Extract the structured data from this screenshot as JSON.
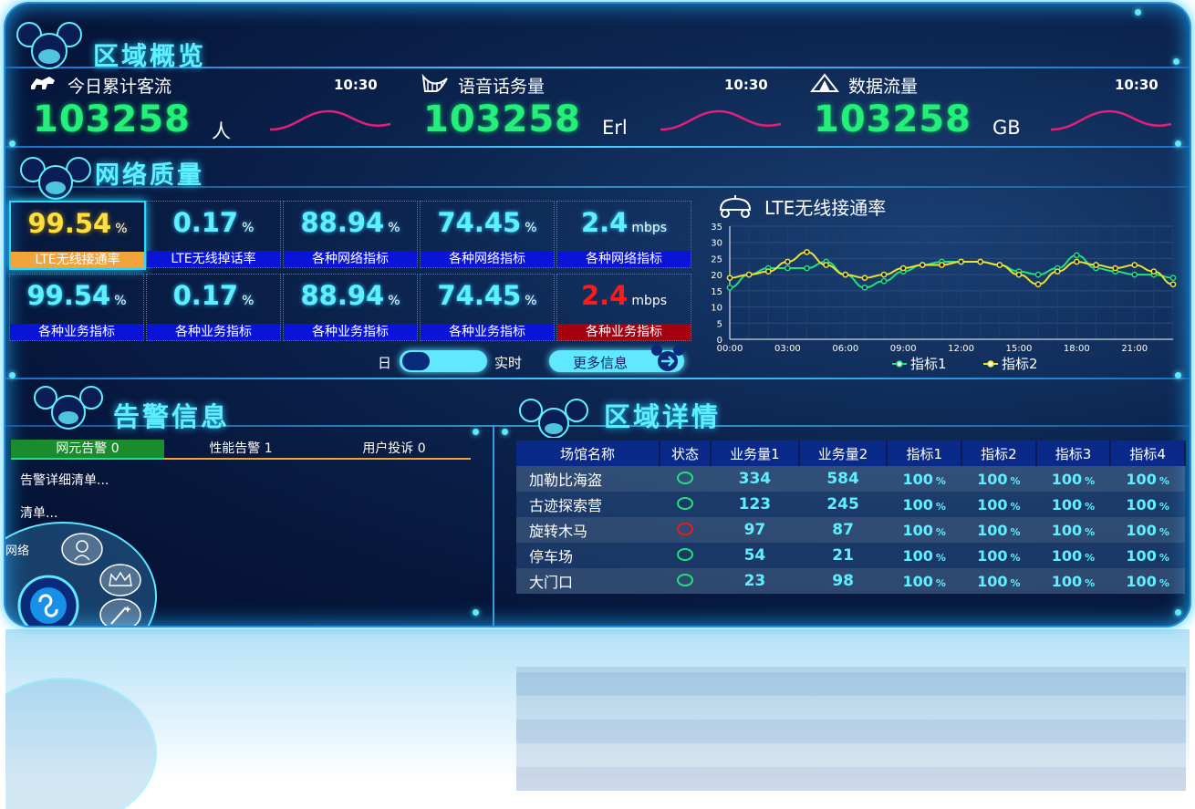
{
  "overview": {
    "title": "区域概览",
    "cards": [
      {
        "icon": "horse-icon",
        "label": "今日累计客流",
        "time": "10:30",
        "value": "103258",
        "unit": "人"
      },
      {
        "icon": "harp-icon",
        "label": "语音话务量",
        "time": "10:30",
        "value": "103258",
        "unit": "Erl"
      },
      {
        "icon": "tent-icon",
        "label": "数据流量",
        "time": "10:30",
        "value": "103258",
        "unit": "GB"
      }
    ]
  },
  "network": {
    "title": "网络质量",
    "row1": [
      {
        "value": "99.54",
        "unit": "%",
        "label": "LTE无线接通率"
      },
      {
        "value": "0.17",
        "unit": "%",
        "label": "LTE无线掉话率"
      },
      {
        "value": "88.94",
        "unit": "%",
        "label": "各种网络指标"
      },
      {
        "value": "74.45",
        "unit": "%",
        "label": "各种网络指标"
      },
      {
        "value": "2.4",
        "unit": "mbps",
        "label": "各种网络指标"
      }
    ],
    "row2": [
      {
        "value": "99.54",
        "unit": "%",
        "label": "各种业务指标"
      },
      {
        "value": "0.17",
        "unit": "%",
        "label": "各种业务指标"
      },
      {
        "value": "88.94",
        "unit": "%",
        "label": "各种业务指标"
      },
      {
        "value": "74.45",
        "unit": "%",
        "label": "各种业务指标"
      },
      {
        "value": "2.4",
        "unit": "mbps",
        "label": "各种业务指标"
      }
    ],
    "toggle_left": "日",
    "toggle_right": "实时",
    "more_button": "更多信息"
  },
  "chart_data": {
    "type": "line",
    "title": "LTE无线接通率",
    "x": [
      "00:00",
      "01:00",
      "02:00",
      "03:00",
      "04:00",
      "05:00",
      "06:00",
      "07:00",
      "08:00",
      "09:00",
      "10:00",
      "11:00",
      "12:00",
      "13:00",
      "14:00",
      "15:00",
      "16:00",
      "17:00",
      "18:00",
      "19:00",
      "20:00",
      "21:00",
      "22:00",
      "23:00"
    ],
    "xticks": [
      "00:00",
      "03:00",
      "06:00",
      "09:00",
      "12:00",
      "15:00",
      "18:00",
      "21:00"
    ],
    "yticks": [
      "0",
      "5",
      "10",
      "15",
      "20",
      "25",
      "30",
      "35"
    ],
    "ylim": [
      0,
      35
    ],
    "grid": true,
    "legend": "bottom",
    "series": [
      {
        "name": "指标1",
        "color": "#22e07a",
        "values": [
          16,
          20,
          22,
          22,
          22,
          24,
          20,
          16,
          18,
          21,
          23,
          24,
          24,
          24,
          23,
          21,
          20,
          22,
          26,
          22,
          21,
          20,
          20,
          19
        ]
      },
      {
        "name": "指标2",
        "color": "#f0e030",
        "values": [
          19,
          20,
          21,
          24,
          27,
          23,
          20,
          19,
          20,
          22,
          23,
          23,
          24,
          24,
          23,
          20,
          17,
          21,
          24,
          23,
          22,
          23,
          21,
          17
        ]
      }
    ]
  },
  "alarm": {
    "title": "告警信息",
    "tabs": [
      "网元告警 0",
      "性能告警 1",
      "用户投诉 0"
    ],
    "lines": [
      "告警详细清单...",
      "清单..."
    ],
    "menu_label": "网络"
  },
  "detail": {
    "title": "区域详情",
    "columns": [
      "场馆名称",
      "状态",
      "业务量1",
      "业务量2",
      "指标1",
      "指标2",
      "指标3",
      "指标4"
    ],
    "pct_unit": "%",
    "rows": [
      {
        "name": "加勒比海盗",
        "status": "ok",
        "v1": "334",
        "v2": "584",
        "i1": "100",
        "i2": "100",
        "i3": "100",
        "i4": "100"
      },
      {
        "name": "古迹探索营",
        "status": "ok",
        "v1": "123",
        "v2": "245",
        "i1": "100",
        "i2": "100",
        "i3": "100",
        "i4": "100"
      },
      {
        "name": "旋转木马",
        "status": "bad",
        "v1": "97",
        "v2": "87",
        "i1": "100",
        "i2": "100",
        "i3": "100",
        "i4": "100"
      },
      {
        "name": "停车场",
        "status": "ok",
        "v1": "54",
        "v2": "21",
        "i1": "100",
        "i2": "100",
        "i3": "100",
        "i4": "100"
      },
      {
        "name": "大门口",
        "status": "ok",
        "v1": "23",
        "v2": "98",
        "i1": "100",
        "i2": "100",
        "i3": "100",
        "i4": "100"
      }
    ]
  }
}
